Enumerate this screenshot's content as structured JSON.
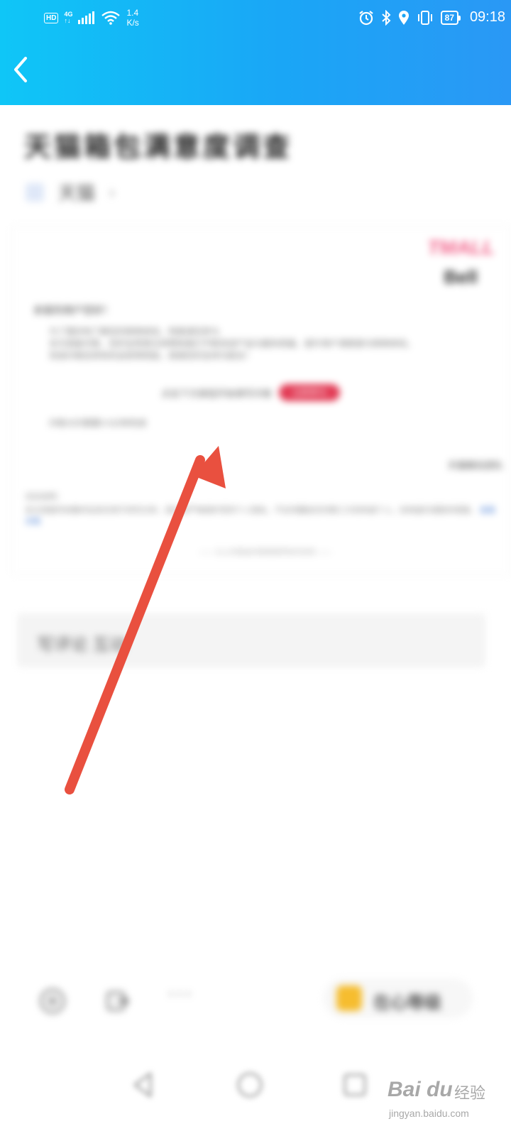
{
  "status_bar": {
    "hd": "HD",
    "network": "4G",
    "network_sub": "↑↓",
    "wifi_sub": "4",
    "speed_value": "1.4",
    "speed_unit": "K/s",
    "battery": "87",
    "time": "09:18"
  },
  "header": {
    "back_icon": "chevron-left-icon"
  },
  "article": {
    "title": "天猫箱包满意度调查",
    "author": "天猫",
    "author_chevron": "›"
  },
  "card": {
    "brand_red": "TMALL",
    "brand_dark": "Bell",
    "intro": "亲爱的用户您好！",
    "lines": [
      "为了更好地了解您的购物体验，特邀请您参与",
      "本次调查问卷，您的宝贵意见将帮助我们不断改进产品与服务质量，提升用户满意度与购物体验。",
      "完成问卷后将有机会获得奖励，感谢您的支持与配合！"
    ],
    "button_prompt": "点击下方按钮开始填写问卷",
    "button_label": "立即参与",
    "note": "问卷大约需要3-5分钟完成",
    "right_note": "天猫箱包团队",
    "footer_label": "活动说明：",
    "footer_lines": "本次调查所收集的信息仅用于研究分析，我们将严格保护您的个人隐私，不会泄露给任何第三方机构或个人。如有疑问请联系客服，",
    "footer_link": "查看详情",
    "bottom_line": "—— 以上内容由问卷星提供技术支持 ——"
  },
  "comment": {
    "placeholder": "写评论 互动"
  },
  "toolbar": {
    "like_icon": "thumb-icon",
    "share_icon": "share-icon",
    "more": "···",
    "pill_label": "在心等级"
  },
  "watermark": {
    "brand": "Bai du",
    "brand_cn": "经验",
    "url": "jingyan.baidu.com"
  },
  "colors": {
    "header_start": "#0fc6f7",
    "header_end": "#2a98f5",
    "arrow": "#e9503f",
    "card_button": "#e23b55"
  }
}
